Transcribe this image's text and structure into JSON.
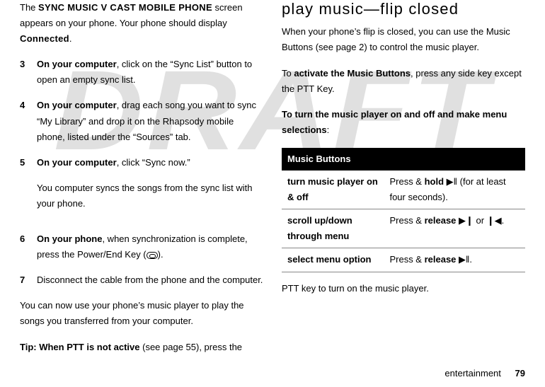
{
  "watermark": "DRAFT",
  "left": {
    "intro_pre": "The ",
    "intro_screen": "SYNC MUSIC V CAST MOBILE PHONE",
    "intro_mid": " screen appears on your phone. Your phone should display ",
    "intro_connected": "Connected",
    "intro_end": ".",
    "step3_num": "3",
    "step3_bold": "On your computer",
    "step3_text": ", click on the “Sync List” button to open an empty sync list.",
    "step4_num": "4",
    "step4_bold": "On your computer",
    "step4_text": ", drag each song you want to sync “My Library” and drop it on the Rhapsody mobile phone, listed under the “Sources” tab.",
    "step5_num": "5",
    "step5_bold": "On your computer",
    "step5_text": ", click “Sync now.”",
    "step5_after": "You computer syncs the songs from the sync list with your phone.",
    "step6_num": "6",
    "step6_bold": "On your phone",
    "step6_text": ", when synchronization is complete, press the Power/End Key (",
    "step6_close": ").",
    "step7_num": "7",
    "step7_text": "Disconnect the cable from the phone and the computer.",
    "outro": "You can now use your phone’s music player to play the songs you transferred from your computer.",
    "tip_bold": "Tip: When PTT is not active",
    "tip_text": " (see page 55), press the "
  },
  "right": {
    "heading": "play music—flip closed",
    "p1": "When your phone’s flip is closed, you can use the Music Buttons (see page 2) to control the music player.",
    "p2_pre": "To ",
    "p2_bold": "activate the Music Buttons",
    "p2_post": ", press any side key except the PTT Key.",
    "p3_bold": "To turn the music player on and off and make menu selections",
    "p3_post": ":",
    "table_header": "Music Buttons",
    "row1_left": "turn music player on & off",
    "row1_right_pre": "Press & ",
    "row1_right_bold": "hold",
    "row1_glyph": "▶‖",
    "row1_right_post": " (for at least four seconds).",
    "row2_left": "scroll up/down through menu",
    "row2_right_pre": "Press & ",
    "row2_right_bold": "release",
    "row2_glyph_a": "▶❙",
    "row2_mid": " or ",
    "row2_glyph_b": "❙◀",
    "row2_end": ".",
    "row3_left": "select menu option",
    "row3_right_pre": "Press & ",
    "row3_right_bold": "release",
    "row3_glyph": "▶‖",
    "row3_end": ".",
    "ptt_line": "PTT key to turn on the music player."
  },
  "footer_label": "entertainment",
  "footer_page": "79"
}
